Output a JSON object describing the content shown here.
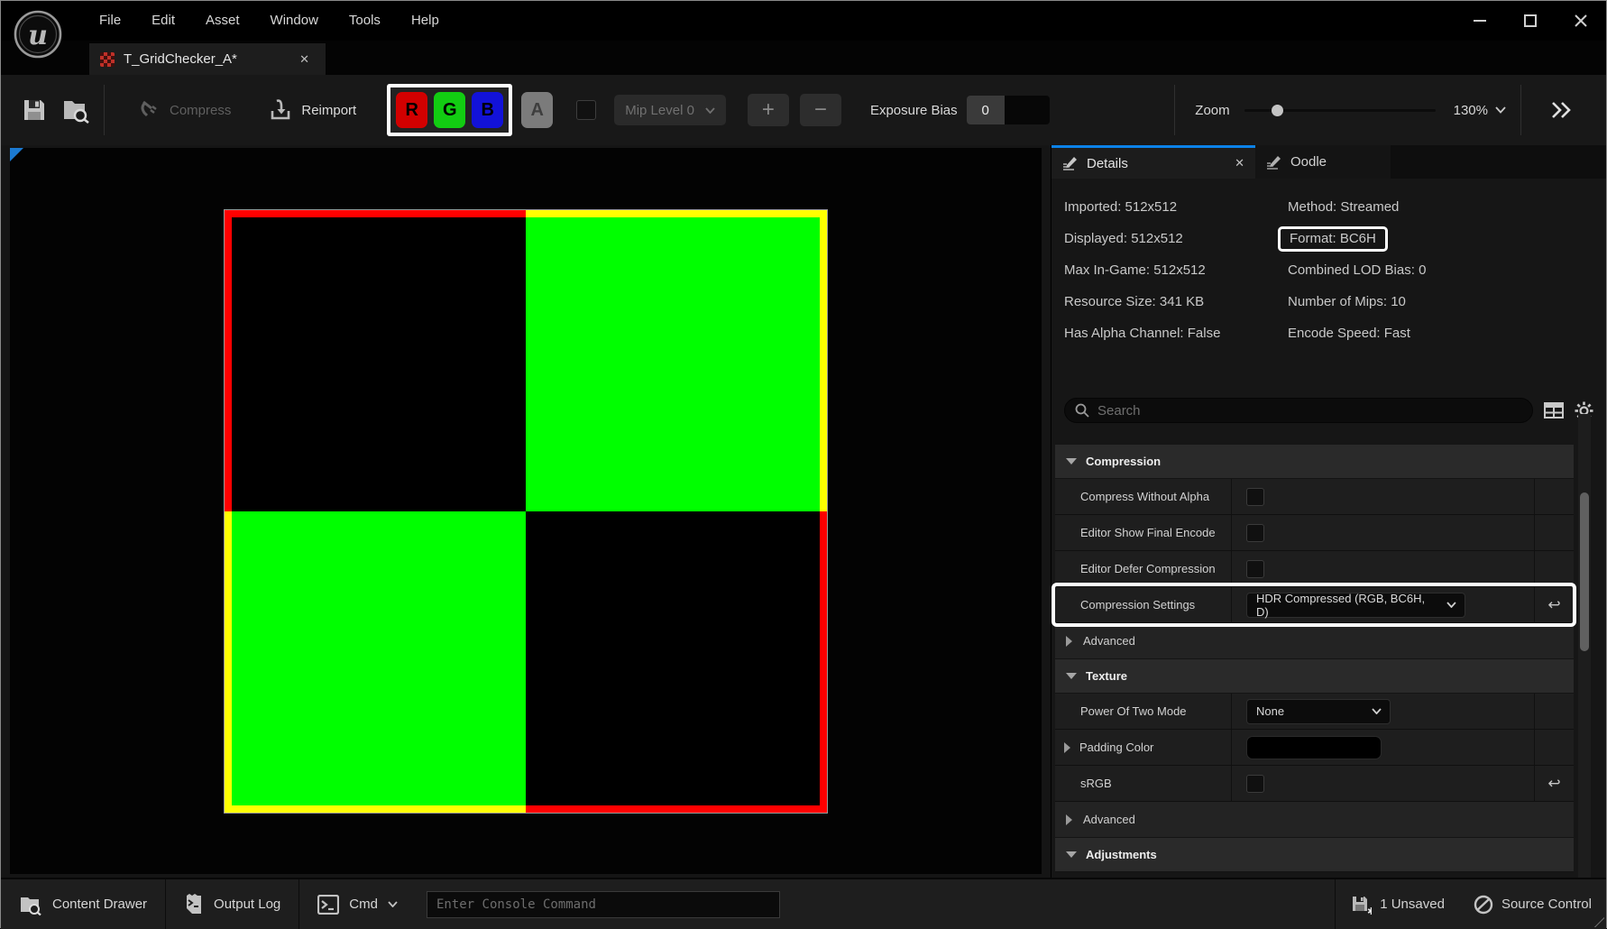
{
  "titlebar": {
    "menus": [
      "File",
      "Edit",
      "Asset",
      "Window",
      "Tools",
      "Help"
    ]
  },
  "tab": {
    "label": "T_GridChecker_A*",
    "close_glyph": "✕"
  },
  "toolbar": {
    "compress_label": "Compress",
    "reimport_label": "Reimport",
    "channel_r": "R",
    "channel_g": "G",
    "channel_b": "B",
    "channel_a": "A",
    "mip_level_label": "Mip Level 0",
    "plus_glyph": "+",
    "minus_glyph": "−",
    "exposure_bias_label": "Exposure Bias",
    "exposure_bias_value": "0",
    "zoom_label": "Zoom",
    "zoom_value": "130%"
  },
  "details_panel": {
    "tab_details": "Details",
    "tab_oodle": "Oodle",
    "tab_close_glyph": "✕",
    "info_left": [
      "Imported: 512x512",
      "Displayed: 512x512",
      "Max In-Game: 512x512",
      "Resource Size: 341 KB",
      "Has Alpha Channel: False"
    ],
    "info_right": [
      "Method: Streamed",
      "Format: BC6H",
      "Combined LOD Bias: 0",
      "Number of Mips: 10",
      "Encode Speed: Fast"
    ],
    "search_placeholder": "Search",
    "sections": {
      "compression": "Compression",
      "texture": "Texture",
      "adjustments": "Adjustments"
    },
    "rows": {
      "compress_without_alpha": "Compress Without Alpha",
      "editor_show_final_encode": "Editor Show Final Encode",
      "editor_defer_compression": "Editor Defer Compression",
      "compression_settings": "Compression Settings",
      "compression_settings_value": "HDR Compressed (RGB, BC6H, D)",
      "advanced": "Advanced",
      "power_of_two_mode": "Power Of Two Mode",
      "power_of_two_mode_value": "None",
      "padding_color": "Padding Color",
      "srgb": "sRGB",
      "advanced2": "Advanced",
      "reset_glyph": "↩"
    }
  },
  "viewport": {
    "texture": {
      "quadrants": [
        [
          "black",
          "green"
        ],
        [
          "green",
          "black"
        ]
      ],
      "green_hex": "#00ff00",
      "border_top_left_hex": "#ff0000",
      "border_top_right_hex": "#ffff00",
      "border_bottom_left_hex": "#ffff00",
      "border_bottom_right_hex": "#ff0000"
    }
  },
  "statusbar": {
    "content_drawer": "Content Drawer",
    "output_log": "Output Log",
    "cmd": "Cmd",
    "console_placeholder": "Enter Console Command",
    "unsaved": "1 Unsaved",
    "source_control": "Source Control"
  },
  "colors": {
    "accent_blue": "#0c82e8",
    "channel_r": "#d20000",
    "channel_g": "#12cc12",
    "channel_b": "#1212d8",
    "highlight_box": "#ffffff"
  }
}
